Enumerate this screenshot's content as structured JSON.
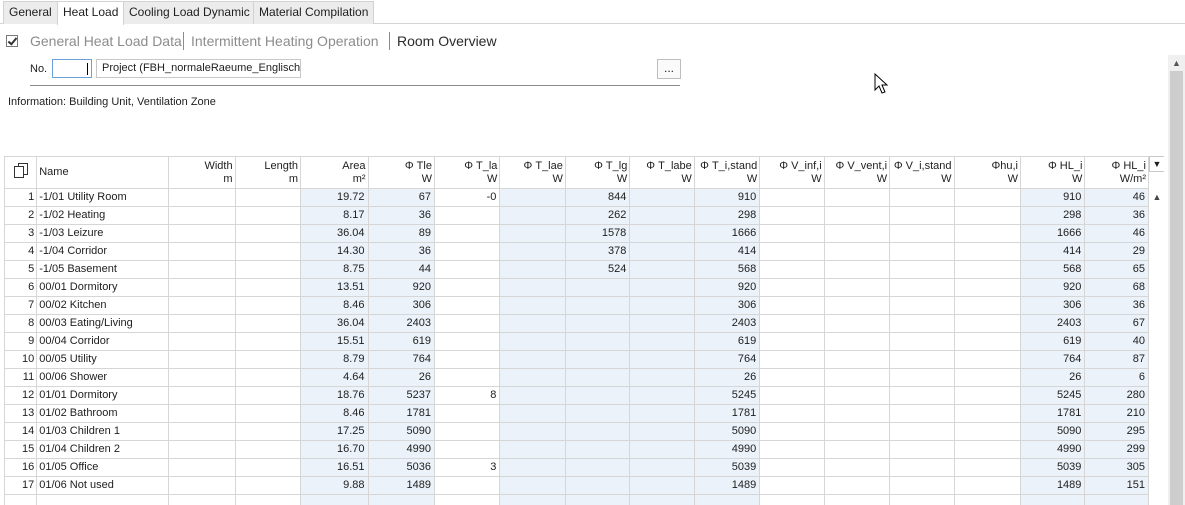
{
  "tabs": [
    {
      "label": "General"
    },
    {
      "label": "Heat Load"
    },
    {
      "label": "Cooling Load Dynamic"
    },
    {
      "label": "Material Compilation"
    }
  ],
  "subnav": {
    "general": "General Heat Load Data",
    "intermittent": "Intermittent Heating Operation",
    "overview": "Room Overview"
  },
  "project": {
    "no_label": "No.",
    "no_value": "",
    "name": "Project (FBH_normaleRaeume_Englisch)",
    "browse_label": "..."
  },
  "info": "Information: Building Unit, Ventilation Zone",
  "grid": {
    "headers": [
      {
        "label": "Name",
        "unit": ""
      },
      {
        "label": "Width",
        "unit": "m"
      },
      {
        "label": "Length",
        "unit": "m"
      },
      {
        "label": "Area",
        "unit": "m²"
      },
      {
        "label": "Φ Tle",
        "unit": "W"
      },
      {
        "label": "Φ T_la",
        "unit": "W"
      },
      {
        "label": "Φ T_lae",
        "unit": "W"
      },
      {
        "label": "Φ T_lg",
        "unit": "W"
      },
      {
        "label": "Φ T_labe",
        "unit": "W"
      },
      {
        "label": "Φ T_i,stand",
        "unit": "W"
      },
      {
        "label": "Φ V_inf,i",
        "unit": "W"
      },
      {
        "label": "Φ V_vent,i",
        "unit": "W"
      },
      {
        "label": "Φ V_i,stand",
        "unit": "W"
      },
      {
        "label": "Φhu,i",
        "unit": "W"
      },
      {
        "label": "Φ HL_i",
        "unit": "W"
      },
      {
        "label": "Φ HL_i",
        "unit": "W/m²"
      }
    ],
    "rows": [
      {
        "idx": "1",
        "name": "-1/01 Utility Room",
        "width": "",
        "length": "",
        "area": "19.72",
        "tle": "67",
        "tla": "-0",
        "tlae": "",
        "tlg": "844",
        "tlabe": "",
        "tistand": "910",
        "vinf": "",
        "vvent": "",
        "vistand": "",
        "hu": "",
        "hl": "910",
        "hlm2": "46"
      },
      {
        "idx": "2",
        "name": "-1/02 Heating",
        "width": "",
        "length": "",
        "area": "8.17",
        "tle": "36",
        "tla": "",
        "tlae": "",
        "tlg": "262",
        "tlabe": "",
        "tistand": "298",
        "vinf": "",
        "vvent": "",
        "vistand": "",
        "hu": "",
        "hl": "298",
        "hlm2": "36"
      },
      {
        "idx": "3",
        "name": "-1/03 Leizure",
        "width": "",
        "length": "",
        "area": "36.04",
        "tle": "89",
        "tla": "",
        "tlae": "",
        "tlg": "1578",
        "tlabe": "",
        "tistand": "1666",
        "vinf": "",
        "vvent": "",
        "vistand": "",
        "hu": "",
        "hl": "1666",
        "hlm2": "46"
      },
      {
        "idx": "4",
        "name": "-1/04 Corridor",
        "width": "",
        "length": "",
        "area": "14.30",
        "tle": "36",
        "tla": "",
        "tlae": "",
        "tlg": "378",
        "tlabe": "",
        "tistand": "414",
        "vinf": "",
        "vvent": "",
        "vistand": "",
        "hu": "",
        "hl": "414",
        "hlm2": "29"
      },
      {
        "idx": "5",
        "name": "-1/05 Basement",
        "width": "",
        "length": "",
        "area": "8.75",
        "tle": "44",
        "tla": "",
        "tlae": "",
        "tlg": "524",
        "tlabe": "",
        "tistand": "568",
        "vinf": "",
        "vvent": "",
        "vistand": "",
        "hu": "",
        "hl": "568",
        "hlm2": "65"
      },
      {
        "idx": "6",
        "name": "00/01 Dormitory",
        "width": "",
        "length": "",
        "area": "13.51",
        "tle": "920",
        "tla": "",
        "tlae": "",
        "tlg": "",
        "tlabe": "",
        "tistand": "920",
        "vinf": "",
        "vvent": "",
        "vistand": "",
        "hu": "",
        "hl": "920",
        "hlm2": "68"
      },
      {
        "idx": "7",
        "name": "00/02 Kitchen",
        "width": "",
        "length": "",
        "area": "8.46",
        "tle": "306",
        "tla": "",
        "tlae": "",
        "tlg": "",
        "tlabe": "",
        "tistand": "306",
        "vinf": "",
        "vvent": "",
        "vistand": "",
        "hu": "",
        "hl": "306",
        "hlm2": "36"
      },
      {
        "idx": "8",
        "name": "00/03 Eating/Living",
        "width": "",
        "length": "",
        "area": "36.04",
        "tle": "2403",
        "tla": "",
        "tlae": "",
        "tlg": "",
        "tlabe": "",
        "tistand": "2403",
        "vinf": "",
        "vvent": "",
        "vistand": "",
        "hu": "",
        "hl": "2403",
        "hlm2": "67"
      },
      {
        "idx": "9",
        "name": "00/04 Corridor",
        "width": "",
        "length": "",
        "area": "15.51",
        "tle": "619",
        "tla": "",
        "tlae": "",
        "tlg": "",
        "tlabe": "",
        "tistand": "619",
        "vinf": "",
        "vvent": "",
        "vistand": "",
        "hu": "",
        "hl": "619",
        "hlm2": "40"
      },
      {
        "idx": "10",
        "name": "00/05 Utility",
        "width": "",
        "length": "",
        "area": "8.79",
        "tle": "764",
        "tla": "",
        "tlae": "",
        "tlg": "",
        "tlabe": "",
        "tistand": "764",
        "vinf": "",
        "vvent": "",
        "vistand": "",
        "hu": "",
        "hl": "764",
        "hlm2": "87"
      },
      {
        "idx": "11",
        "name": "00/06 Shower",
        "width": "",
        "length": "",
        "area": "4.64",
        "tle": "26",
        "tla": "",
        "tlae": "",
        "tlg": "",
        "tlabe": "",
        "tistand": "26",
        "vinf": "",
        "vvent": "",
        "vistand": "",
        "hu": "",
        "hl": "26",
        "hlm2": "6"
      },
      {
        "idx": "12",
        "name": "01/01 Dormitory",
        "width": "",
        "length": "",
        "area": "18.76",
        "tle": "5237",
        "tla": "8",
        "tlae": "",
        "tlg": "",
        "tlabe": "",
        "tistand": "5245",
        "vinf": "",
        "vvent": "",
        "vistand": "",
        "hu": "",
        "hl": "5245",
        "hlm2": "280"
      },
      {
        "idx": "13",
        "name": "01/02 Bathroom",
        "width": "",
        "length": "",
        "area": "8.46",
        "tle": "1781",
        "tla": "",
        "tlae": "",
        "tlg": "",
        "tlabe": "",
        "tistand": "1781",
        "vinf": "",
        "vvent": "",
        "vistand": "",
        "hu": "",
        "hl": "1781",
        "hlm2": "210"
      },
      {
        "idx": "14",
        "name": "01/03 Children 1",
        "width": "",
        "length": "",
        "area": "17.25",
        "tle": "5090",
        "tla": "",
        "tlae": "",
        "tlg": "",
        "tlabe": "",
        "tistand": "5090",
        "vinf": "",
        "vvent": "",
        "vistand": "",
        "hu": "",
        "hl": "5090",
        "hlm2": "295"
      },
      {
        "idx": "15",
        "name": "01/04 Children 2",
        "width": "",
        "length": "",
        "area": "16.70",
        "tle": "4990",
        "tla": "",
        "tlae": "",
        "tlg": "",
        "tlabe": "",
        "tistand": "4990",
        "vinf": "",
        "vvent": "",
        "vistand": "",
        "hu": "",
        "hl": "4990",
        "hlm2": "299"
      },
      {
        "idx": "16",
        "name": "01/05 Office",
        "width": "",
        "length": "",
        "area": "16.51",
        "tle": "5036",
        "tla": "3",
        "tlae": "",
        "tlg": "",
        "tlabe": "",
        "tistand": "5039",
        "vinf": "",
        "vvent": "",
        "vistand": "",
        "hu": "",
        "hl": "5039",
        "hlm2": "305"
      },
      {
        "idx": "17",
        "name": "01/06 Not used",
        "width": "",
        "length": "",
        "area": "9.88",
        "tle": "1489",
        "tla": "",
        "tlae": "",
        "tlg": "",
        "tlabe": "",
        "tistand": "1489",
        "vinf": "",
        "vvent": "",
        "vistand": "",
        "hu": "",
        "hl": "1489",
        "hlm2": "151"
      }
    ]
  },
  "colors": {
    "shade": "#ebf2f9",
    "border": "#d6d6d6",
    "input_focus": "#6aa0d8"
  },
  "icons": {
    "copy": "copy-icon",
    "checkbox": "checkbox-checked-icon",
    "cursor": "mouse-pointer-icon",
    "scroll_up": "chevron-up-icon",
    "column_menu": "chevron-down-icon"
  }
}
